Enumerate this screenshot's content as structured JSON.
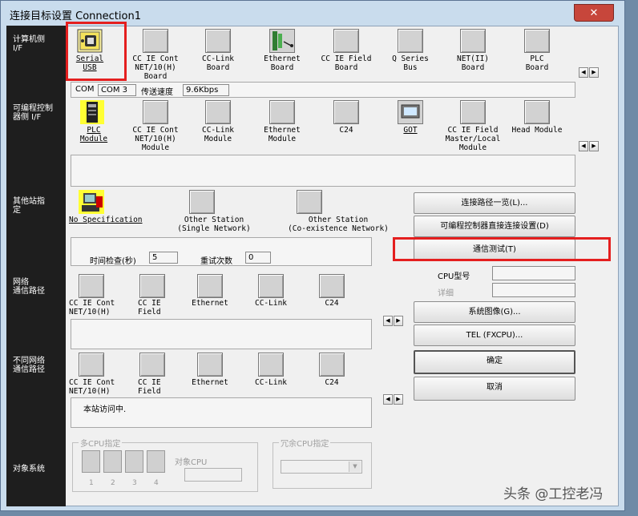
{
  "window": {
    "title": "连接目标设置 Connection1",
    "close": "✕"
  },
  "sections": {
    "pc_if": "计算机侧\nI/F",
    "plc_if": "可编程控制\n器侧 I/F",
    "other_station": "其他站指\n定",
    "network_route": "网络\n通信路径",
    "diff_network_route": "不同网络\n通信路径",
    "target_system": "对象系统"
  },
  "pc_interfaces": [
    {
      "label": "Serial\nUSB",
      "icon": "serial-usb-icon"
    },
    {
      "label": "CC IE Cont\nNET/10(H)\nBoard",
      "icon": "board-icon"
    },
    {
      "label": "CC-Link\nBoard",
      "icon": "board-icon"
    },
    {
      "label": "Ethernet\nBoard",
      "icon": "ethernet-icon"
    },
    {
      "label": "CC IE Field\nBoard",
      "icon": "board-icon"
    },
    {
      "label": "Q Series\nBus",
      "icon": "board-icon"
    },
    {
      "label": "NET(II)\nBoard",
      "icon": "board-icon"
    },
    {
      "label": "PLC\nBoard",
      "icon": "board-icon"
    }
  ],
  "com_row": {
    "com_label": "COM",
    "com_value": "COM 3",
    "speed_label": "传送速度",
    "speed_value": "9.6Kbps"
  },
  "plc_interfaces": [
    {
      "label": "PLC\nModule",
      "icon": "plc-module-icon"
    },
    {
      "label": "CC IE Cont\nNET/10(H)\nModule",
      "icon": "module-icon"
    },
    {
      "label": "CC-Link\nModule",
      "icon": "module-icon"
    },
    {
      "label": "Ethernet\nModule",
      "icon": "module-icon"
    },
    {
      "label": "C24",
      "icon": "module-icon"
    },
    {
      "label": "GOT",
      "icon": "got-icon"
    },
    {
      "label": "CC IE Field\nMaster/Local\nModule",
      "icon": "module-icon"
    },
    {
      "label": "Head Module",
      "icon": "module-icon"
    }
  ],
  "other_stations": [
    {
      "label": "No Specification",
      "icon": "no-spec-icon"
    },
    {
      "label": "Other Station\n(Single Network)",
      "icon": "station-icon"
    },
    {
      "label": "Other Station\n(Co-existence Network)",
      "icon": "station-icon"
    }
  ],
  "timing": {
    "check_label": "时间检查(秒)",
    "check_value": "5",
    "retry_label": "重试次数",
    "retry_value": "0"
  },
  "network_items": [
    {
      "label": "CC IE Cont\nNET/10(H)"
    },
    {
      "label": "CC IE\nField"
    },
    {
      "label": "Ethernet"
    },
    {
      "label": "CC-Link"
    },
    {
      "label": "C24"
    }
  ],
  "diff_network_items": [
    {
      "label": "CC IE Cont\nNET/10(H)"
    },
    {
      "label": "CC IE\nField"
    },
    {
      "label": "Ethernet"
    },
    {
      "label": "CC-Link"
    },
    {
      "label": "C24"
    }
  ],
  "status_text": "本站访问中.",
  "buttons": {
    "route_list": "连接路径一览(L)...",
    "direct_connect": "可编程控制器直接连接设置(D)",
    "comm_test": "通信测试(T)",
    "system_image": "系统图像(G)...",
    "tel": "TEL (FXCPU)...",
    "ok": "确定",
    "cancel": "取消"
  },
  "cpu_info": {
    "model_label": "CPU型号",
    "detail_label": "详细"
  },
  "multi_cpu": {
    "group_label": "多CPU指定",
    "target_label": "对象CPU",
    "numbers": [
      "1",
      "2",
      "3",
      "4"
    ]
  },
  "redundant_cpu": {
    "group_label": "冗余CPU指定"
  },
  "watermark": "头条 @工控老冯",
  "colors": {
    "highlight": "#e41f1f",
    "sidebar": "#1e1e1e"
  }
}
